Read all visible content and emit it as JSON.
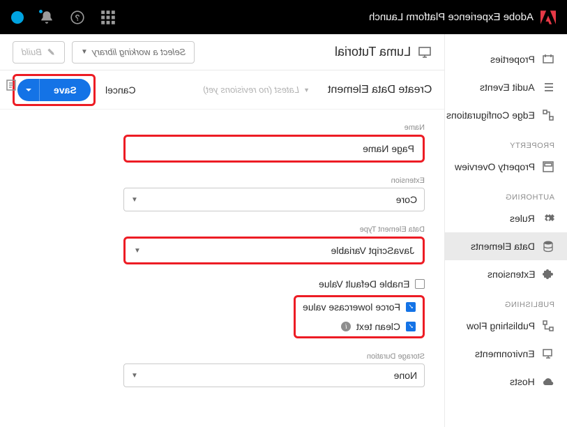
{
  "topbar": {
    "title": "Adobe Experience Platform Launch"
  },
  "sidebar": {
    "items": [
      {
        "label": "Properties"
      },
      {
        "label": "Audit Events"
      },
      {
        "label": "Edge Configurations"
      }
    ],
    "property_header": "PROPERTY",
    "property_items": [
      {
        "label": "Property Overview"
      }
    ],
    "authoring_header": "AUTHORING",
    "authoring_items": [
      {
        "label": "Rules"
      },
      {
        "label": "Data Elements"
      },
      {
        "label": "Extensions"
      }
    ],
    "publishing_header": "PUBLISHING",
    "publishing_items": [
      {
        "label": "Publishing Flow"
      },
      {
        "label": "Environments"
      },
      {
        "label": "Hosts"
      }
    ]
  },
  "header": {
    "property_title": "Luma Tutorial",
    "library_select": "Select a working library",
    "build_label": "Build"
  },
  "subheader": {
    "title": "Create Data Element",
    "revision_text": "Latest (no revisions yet)",
    "cancel": "Cancel",
    "save": "Save"
  },
  "form": {
    "name_label": "Name",
    "name_value": "Page Name",
    "extension_label": "Extension",
    "extension_value": "Core",
    "type_label": "Data Element Type",
    "type_value": "JavaScript Variable",
    "enable_default_label": "Enable Default Value",
    "force_lowercase_label": "Force lowercase value",
    "clean_text_label": "Clean text",
    "storage_label": "Storage Duration",
    "storage_value": "None"
  }
}
